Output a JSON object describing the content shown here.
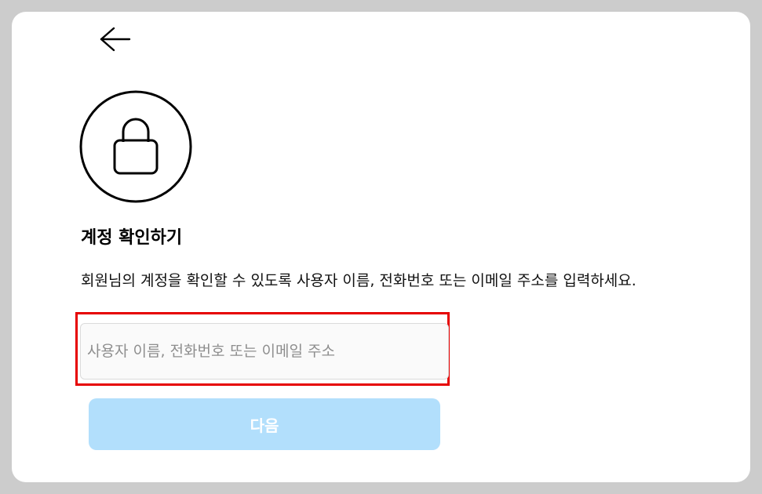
{
  "header": {
    "back_icon": "arrow-left-icon"
  },
  "hero": {
    "icon": "lock-icon"
  },
  "main": {
    "title": "계정 확인하기",
    "description": "회원님의 계정을 확인할 수 있도록 사용자 이름, 전화번호 또는 이메일 주소를 입력하세요.",
    "input": {
      "placeholder": "사용자 이름, 전화번호 또는 이메일 주소",
      "value": ""
    },
    "next_label": "다음"
  },
  "colors": {
    "page_background": "#cccccc",
    "card_background": "#ffffff",
    "button_disabled": "#b2dffc",
    "highlight": "#e60000"
  }
}
